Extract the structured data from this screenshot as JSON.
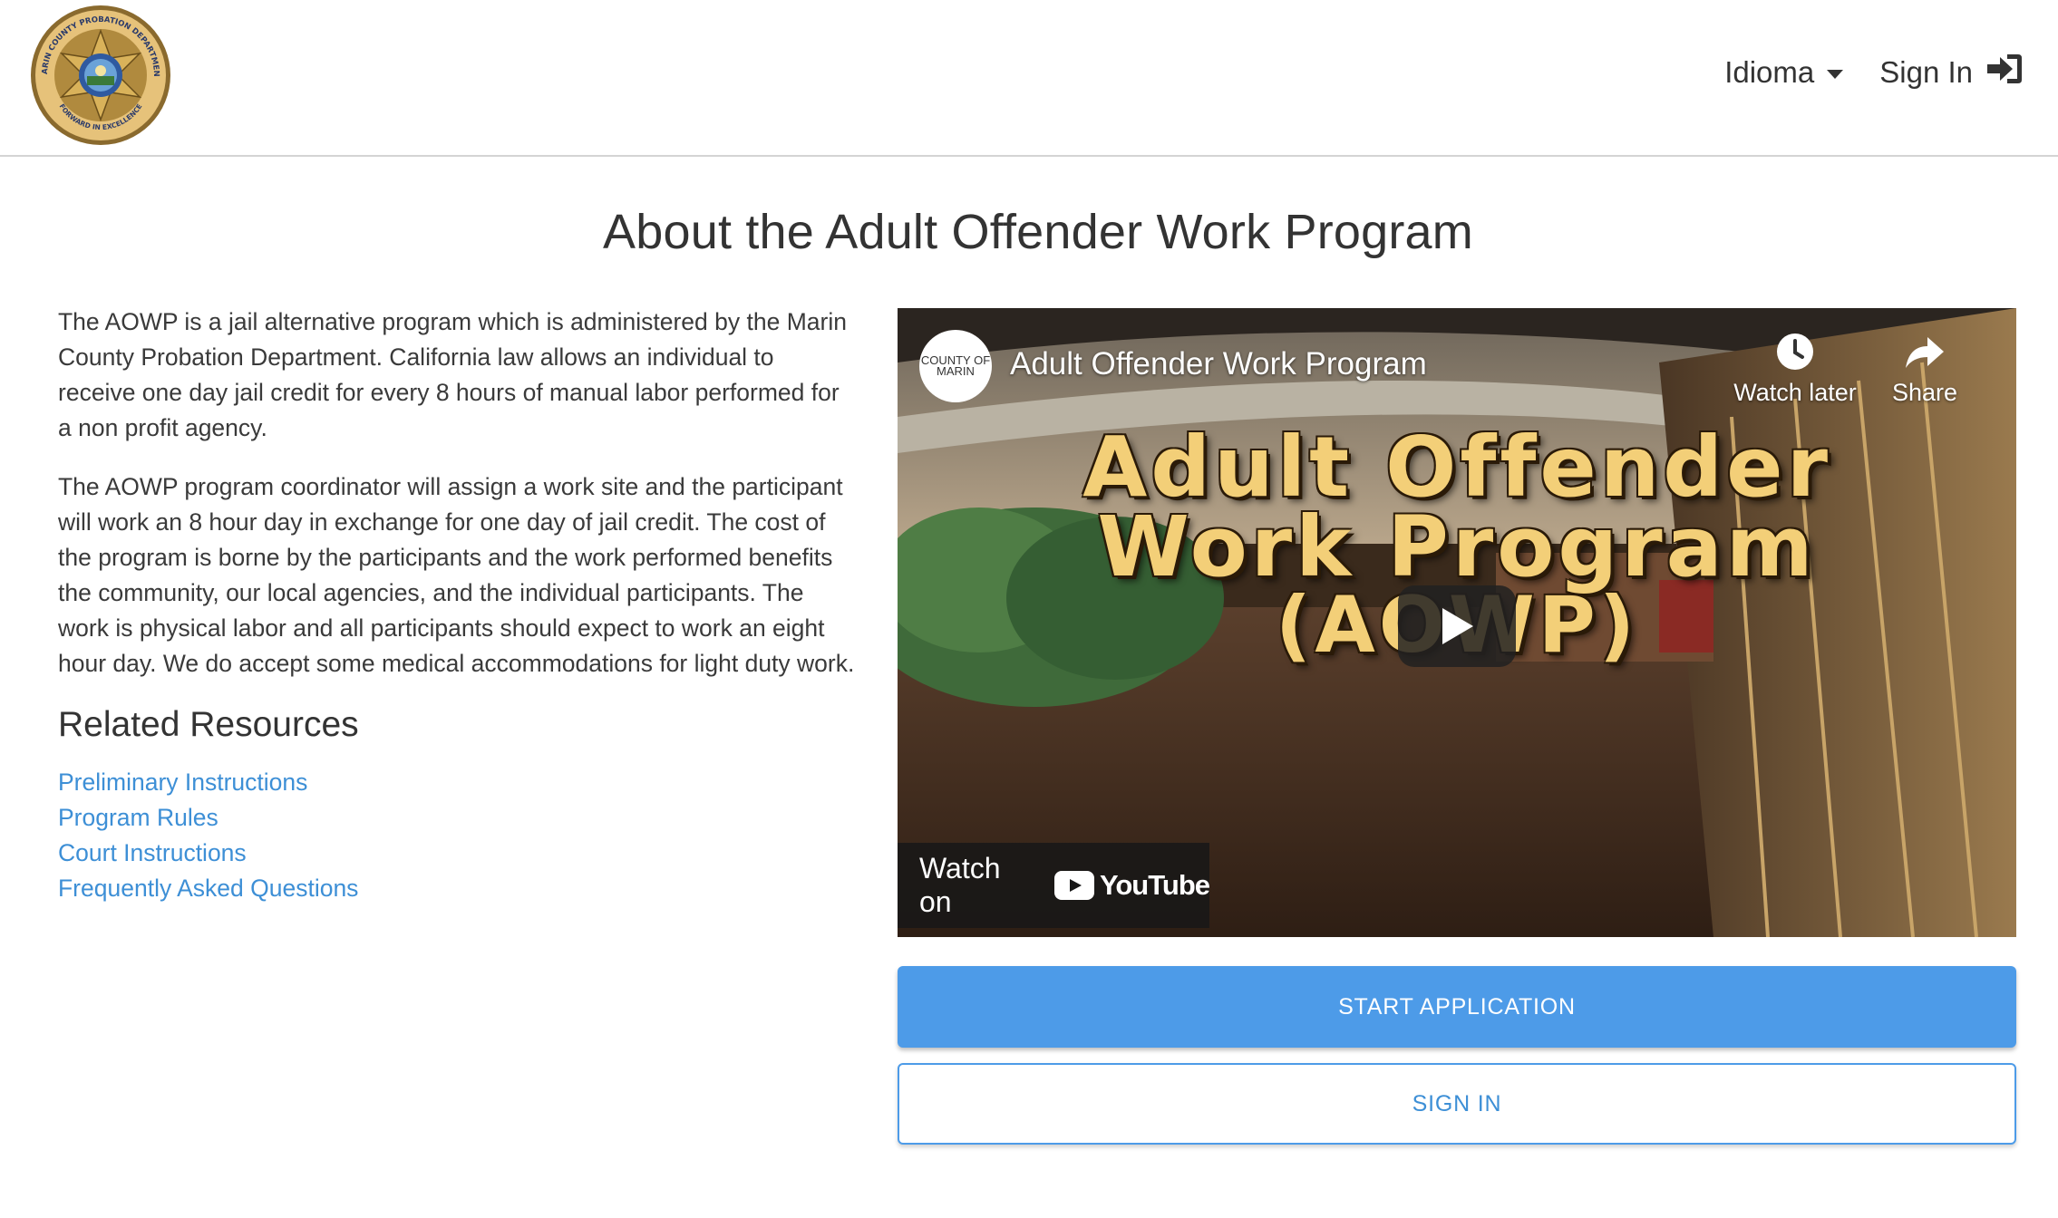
{
  "header": {
    "logo_alt": "Marin County Probation Department seal",
    "logo_text": [
      "MARIN COUNTY PROBATION DEPARTMENT",
      "FORWARD IN EXCELLENCE"
    ],
    "language_label": "Idioma",
    "signin_label": "Sign In"
  },
  "main": {
    "title": "About the Adult Offender Work Program",
    "paragraphs": [
      "The AOWP is a jail alternative program which is administered by the Marin County Probation Department. California law allows an individual to receive one day jail credit for every 8 hours of manual labor performed for a non profit agency.",
      "The AOWP program coordinator will assign a work site and the participant will work an 8 hour day in exchange for one day of jail credit. The cost of the program is borne by the participants and the work performed benefits the community, our local agencies, and the individual participants. The work is physical labor and all participants should expect to work an eight hour day. We do accept some medical accommodations for light duty work."
    ],
    "resources_heading": "Related Resources",
    "resources": [
      "Preliminary Instructions",
      "Program Rules",
      "Court Instructions",
      "Frequently Asked Questions"
    ]
  },
  "video": {
    "channel_name": "COUNTY OF MARIN",
    "title": "Adult Offender Work Program",
    "watch_later_label": "Watch later",
    "share_label": "Share",
    "thumbnail_lines": [
      "Adult Offender",
      "Work Program",
      "(AOWP)"
    ],
    "watch_on_label": "Watch on",
    "youtube_label": "YouTube"
  },
  "actions": {
    "start_label": "START APPLICATION",
    "signin_label": "SIGN IN"
  },
  "colors": {
    "link": "#3d8fd6",
    "primary_button": "#4d9be8",
    "thumbnail_title": "#f3cf78"
  },
  "icons": [
    "caret-down-icon",
    "sign-in-icon",
    "clock-icon",
    "share-icon",
    "play-icon",
    "youtube-icon"
  ]
}
